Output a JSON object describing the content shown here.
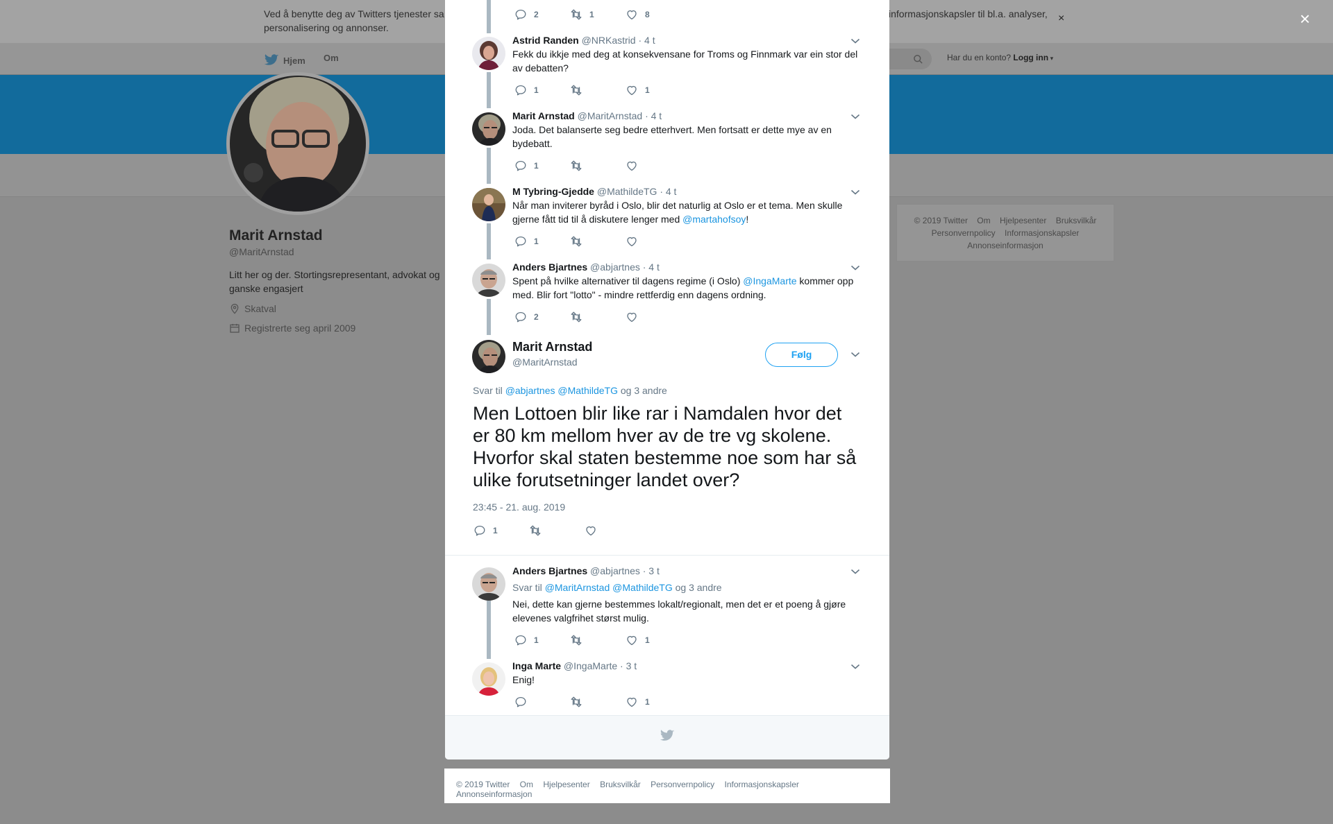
{
  "cookie_banner": {
    "text": "Ved å benytte deg av Twitters tjenester sa",
    "text_right": "informasjonskapsler til bl.a. analyser,",
    "text_line2": "personalisering og annonser.",
    "close": "×"
  },
  "overlay_close": "×",
  "nav": {
    "home": "Hjem",
    "about": "Om",
    "account_prompt": "Har du en konto?",
    "login": "Logg inn"
  },
  "profile": {
    "name": "Marit Arnstad",
    "handle": "@MaritArnstad",
    "bio": "Litt her og der. Stortingsrepresentant, advokat og ganske engasjert",
    "location": "Skatval",
    "joined": "Registrerte seg april 2009"
  },
  "sidebar_footer": {
    "copyright": "© 2019 Twitter",
    "about": "Om",
    "help": "Hjelpesenter",
    "terms": "Bruksvilkår",
    "privacy": "Personvernpolicy",
    "cookies": "Informasjonskapsler",
    "ads": "Annonseinformasjon"
  },
  "top_actions": {
    "replies": "2",
    "retweets": "1",
    "likes": "8"
  },
  "thread": [
    {
      "name": "Astrid Randen",
      "handle": "@NRKastrid",
      "time": "· 4 t",
      "text": "Fekk du ikkje med deg at konsekvensane for Troms og Finnmark var ein stor del av debatten?",
      "replies": "1",
      "retweets": "",
      "likes": "1"
    },
    {
      "name": "Marit Arnstad",
      "handle": "@MaritArnstad",
      "time": "· 4 t",
      "text": "Joda. Det balanserte seg bedre etterhvert. Men fortsatt er dette mye av en bydebatt.",
      "replies": "1",
      "retweets": "",
      "likes": ""
    },
    {
      "name": "M Tybring-Gjedde",
      "handle": "@MathildeTG",
      "time": "· 4 t",
      "text": "Når man inviterer byråd i Oslo, blir det naturlig at Oslo er et tema. Men skulle gjerne fått tid til å diskutere lenger med ",
      "mention": "@martahofsoy",
      "text_end": "!",
      "replies": "1",
      "retweets": "",
      "likes": ""
    },
    {
      "name": "Anders Bjartnes",
      "handle": "@abjartnes",
      "time": "· 4 t",
      "text": "Spent på hvilke alternativer til dagens regime (i Oslo) ",
      "mention": "@IngaMarte",
      "text_end": " kommer opp med. Blir fort \"lotto\" - mindre rettferdig enn dagens ordning.",
      "replies": "2",
      "retweets": "",
      "likes": ""
    }
  ],
  "main_tweet": {
    "name": "Marit Arnstad",
    "handle": "@MaritArnstad",
    "follow": "Følg",
    "reply_prefix": "Svar til",
    "reply_to_1": "@abjartnes",
    "reply_to_2": "@MathildeTG",
    "reply_suffix": "og 3 andre",
    "text": "Men Lottoen blir like rar i Namdalen hvor det er 80 km mellom hver av de tre vg skolene. Hvorfor skal staten bestemme noe som har så ulike forutsetninger landet over?",
    "timestamp": "23:45 - 21. aug. 2019",
    "replies": "1",
    "retweets": "",
    "likes": ""
  },
  "replies": [
    {
      "name": "Anders Bjartnes",
      "handle": "@abjartnes",
      "time": "· 3 t",
      "reply_prefix": "Svar til",
      "reply_to_1": "@MaritArnstad",
      "reply_to_2": "@MathildeTG",
      "reply_suffix": "og 3 andre",
      "text": "Nei, dette kan gjerne bestemmes lokalt/regionalt, men det er et poeng å gjøre elevenes valgfrihet størst mulig.",
      "replies": "1",
      "retweets": "",
      "likes": "1"
    },
    {
      "name": "Inga Marte",
      "handle": "@IngaMarte",
      "time": "· 3 t",
      "text": "Enig!",
      "replies": "",
      "retweets": "",
      "likes": "1"
    }
  ],
  "page_footer": {
    "copyright": "© 2019 Twitter",
    "about": "Om",
    "help": "Hjelpesenter",
    "terms": "Bruksvilkår",
    "privacy": "Personvernpolicy",
    "cookies": "Informasjonskapsler",
    "ads": "Annonseinformasjon"
  },
  "colors": {
    "link": "#1b95e0",
    "header_blue": "#126b9c",
    "line": "#aab8c2"
  },
  "icons": [
    "bird-icon",
    "search-icon",
    "location-icon",
    "calendar-icon",
    "reply-icon",
    "retweet-icon",
    "like-icon",
    "chevron-down-icon",
    "close-icon"
  ]
}
